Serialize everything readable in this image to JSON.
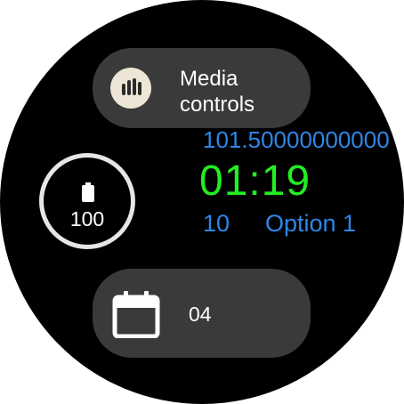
{
  "complications": {
    "media": {
      "label": "Media controls",
      "icon": "media-controls-icon"
    },
    "battery": {
      "level": "100",
      "icon": "battery-icon"
    },
    "calendar": {
      "day": "04",
      "icon": "calendar-icon"
    }
  },
  "values": {
    "long_value": "101.50000000000",
    "time": "01:19",
    "number": "10",
    "option": "Option 1"
  },
  "colors": {
    "background": "#000000",
    "pill": "#3a3a3a",
    "time_green": "#22ee22",
    "value_blue": "#2f86e6",
    "ring": "#e6e6e6",
    "media_icon_bg": "#ede6d6"
  }
}
